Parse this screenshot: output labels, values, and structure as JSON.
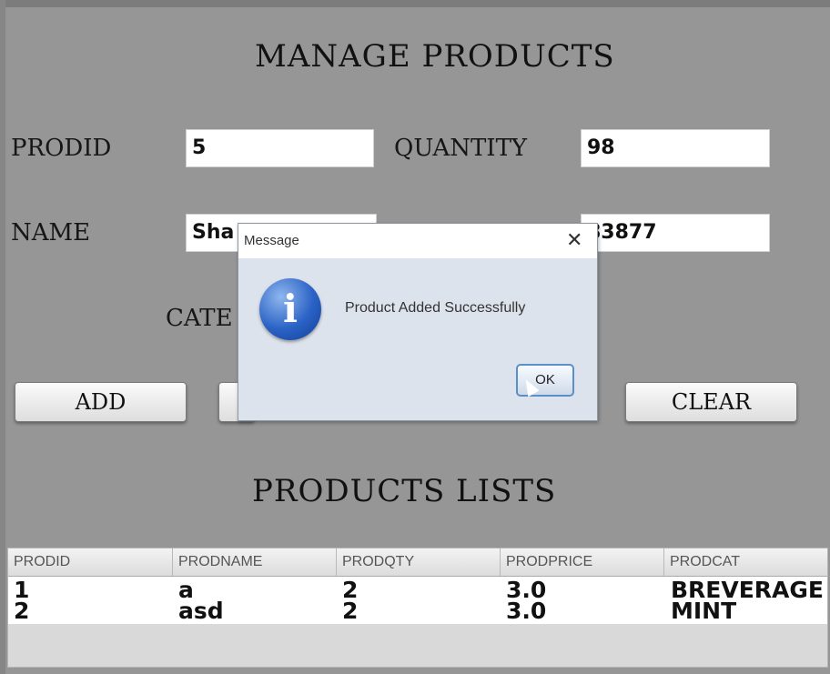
{
  "form": {
    "title": "MANAGE PRODUCTS",
    "prodid_label": "PRODID",
    "prodid_value": "5",
    "quantity_label": "QUANTITY",
    "quantity_value": "98",
    "name_label": "NAME",
    "name_value": "Sha",
    "price_value": "83877",
    "category_label_visible": "CATE"
  },
  "buttons": {
    "add": "ADD",
    "clear": "CLEAR"
  },
  "list": {
    "title": "PRODUCTS LISTS",
    "columns": [
      "PRODID",
      "PRODNAME",
      "PRODQTY",
      "PRODPRICE",
      "PRODCAT"
    ],
    "rows": [
      [
        "1",
        "a",
        "2",
        "3.0",
        "BREVERAGE"
      ],
      [
        "2",
        "asd",
        "2",
        "3.0",
        "MINT"
      ]
    ]
  },
  "dialog": {
    "title": "Message",
    "close_icon": "close-icon",
    "icon": "info-icon",
    "message": "Product Added Successfully",
    "ok_label": "OK"
  }
}
